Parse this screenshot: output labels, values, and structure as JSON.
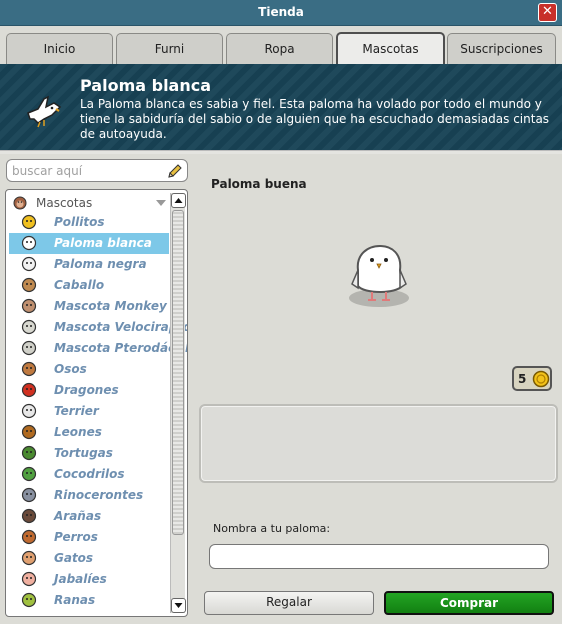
{
  "window": {
    "title": "Tienda",
    "close_label": "✕"
  },
  "tabs": [
    {
      "label": "Inicio"
    },
    {
      "label": "Furni"
    },
    {
      "label": "Ropa"
    },
    {
      "label": "Mascotas",
      "active": true
    },
    {
      "label": "Suscripciones"
    }
  ],
  "banner": {
    "title": "Paloma blanca",
    "description": "La Paloma blanca es sabia y fiel. Esta paloma ha volado por todo el mundo y tiene la sabiduría del sabio o de alguien que ha escuchado demasiadas cintas de autoayuda.",
    "icon": "white-dove-icon"
  },
  "search": {
    "placeholder": "buscar aquí",
    "value": ""
  },
  "catalog": {
    "category": "Mascotas",
    "items": [
      {
        "label": "Pollitos",
        "icon": "chick-icon",
        "color": "#f0c020"
      },
      {
        "label": "Paloma blanca",
        "icon": "white-dove-icon",
        "color": "#ffffff",
        "selected": true
      },
      {
        "label": "Paloma negra",
        "icon": "black-dove-icon",
        "color": "#f2f2f2"
      },
      {
        "label": "Caballo",
        "icon": "horse-icon",
        "color": "#c08a50"
      },
      {
        "label": "Mascota Monkey",
        "icon": "monkey-icon",
        "color": "#c09070"
      },
      {
        "label": "Mascota Velociraptor",
        "icon": "velociraptor-icon",
        "color": "#d8d8d0"
      },
      {
        "label": "Mascota Pterodáctilo",
        "icon": "pterodactyl-icon",
        "color": "#d0d0c8"
      },
      {
        "label": "Osos",
        "icon": "bear-icon",
        "color": "#c07a40"
      },
      {
        "label": "Dragones",
        "icon": "dragon-icon",
        "color": "#d03020"
      },
      {
        "label": "Terrier",
        "icon": "terrier-icon",
        "color": "#e8e8e8"
      },
      {
        "label": "Leones",
        "icon": "lion-icon",
        "color": "#b06a20"
      },
      {
        "label": "Tortugas",
        "icon": "turtle-icon",
        "color": "#4a8a30"
      },
      {
        "label": "Cocodrilos",
        "icon": "crocodile-icon",
        "color": "#50a040"
      },
      {
        "label": "Rinocerontes",
        "icon": "rhino-icon",
        "color": "#8890a0"
      },
      {
        "label": "Arañas",
        "icon": "spider-icon",
        "color": "#6a4a3a"
      },
      {
        "label": "Perros",
        "icon": "dog-icon",
        "color": "#c06a30"
      },
      {
        "label": "Gatos",
        "icon": "cat-icon",
        "color": "#e0a070"
      },
      {
        "label": "Jabalíes",
        "icon": "boar-icon",
        "color": "#f0b0a0"
      },
      {
        "label": "Ranas",
        "icon": "frog-icon",
        "color": "#a0c040"
      }
    ]
  },
  "detail": {
    "product_name": "Paloma buena",
    "price": "5",
    "price_icon": "credit-coin-icon",
    "name_label": "Nombra a tu paloma:",
    "name_value": "",
    "gift_label": "Regalar",
    "buy_label": "Comprar"
  },
  "colors": {
    "titlebar": "#3a6d84",
    "banner": "#184356",
    "selected_row": "#7dc8e8",
    "item_text": "#6e8fb0",
    "buy_button": "#1a9a1a",
    "close_button": "#c8302a"
  }
}
